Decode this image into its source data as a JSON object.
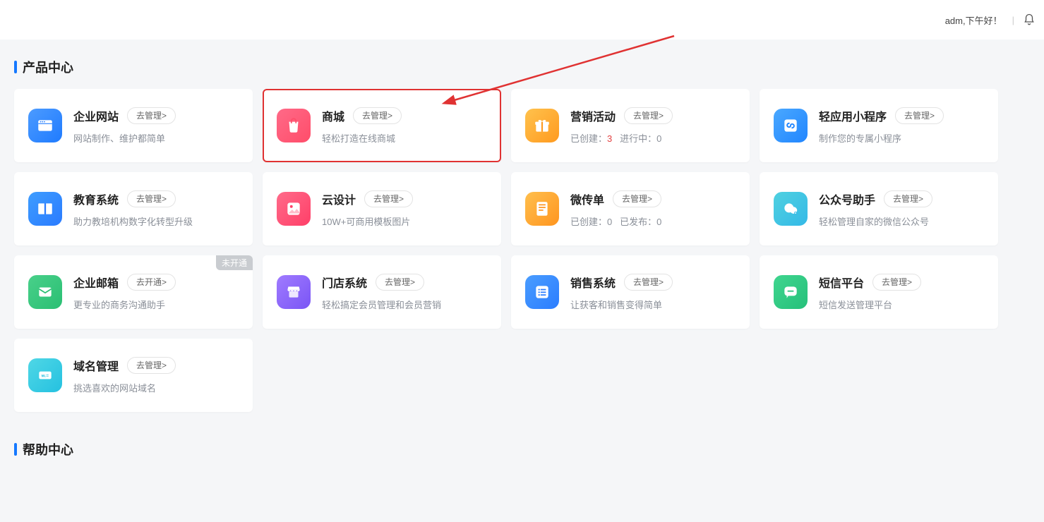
{
  "header": {
    "greeting": "adm,下午好！"
  },
  "sections": {
    "products": "产品中心",
    "help": "帮助中心"
  },
  "badge_unopened": "未开通",
  "cards": [
    {
      "title": "企业网站",
      "btn": "去管理>",
      "sub": "网站制作、维护都简单",
      "icon": "window-icon",
      "bg": "bg-blue"
    },
    {
      "title": "商城",
      "btn": "去管理>",
      "sub": "轻松打造在线商城",
      "icon": "shopping-bag-icon",
      "bg": "bg-pink",
      "highlight": true
    },
    {
      "title": "营销活动",
      "btn": "去管理>",
      "sub_label1": "已创建：",
      "sub_val1": "3",
      "sub_label2": "进行中：",
      "sub_val2": "0",
      "icon": "gift-icon",
      "bg": "bg-orange",
      "stats": true
    },
    {
      "title": "轻应用小程序",
      "btn": "去管理>",
      "sub": "制作您的专属小程序",
      "icon": "miniapp-icon",
      "bg": "bg-blue2"
    },
    {
      "title": "教育系统",
      "btn": "去管理>",
      "sub": "助力教培机构数字化转型升级",
      "icon": "book-icon",
      "bg": "bg-blue3"
    },
    {
      "title": "云设计",
      "btn": "去管理>",
      "sub": "10W+可商用模板图片",
      "icon": "image-icon",
      "bg": "bg-pink2"
    },
    {
      "title": "微传单",
      "btn": "去管理>",
      "sub_label1": "已创建：",
      "sub_val1": "0",
      "sub_label2": "已发布：",
      "sub_val2": "0",
      "icon": "flyer-icon",
      "bg": "bg-orange2",
      "stats": true,
      "val1_gray": true
    },
    {
      "title": "公众号助手",
      "btn": "去管理>",
      "sub": "轻松管理自家的微信公众号",
      "icon": "wechat-icon",
      "bg": "bg-wechat"
    },
    {
      "title": "企业邮箱",
      "btn": "去开通>",
      "sub": "更专业的商务沟通助手",
      "icon": "mail-icon",
      "bg": "bg-green",
      "badge": true
    },
    {
      "title": "门店系统",
      "btn": "去管理>",
      "sub": "轻松搞定会员管理和会员营销",
      "icon": "store-icon",
      "bg": "bg-purple"
    },
    {
      "title": "销售系统",
      "btn": "去管理>",
      "sub": "让获客和销售变得简单",
      "icon": "list-icon",
      "bg": "bg-bluef"
    },
    {
      "title": "短信平台",
      "btn": "去管理>",
      "sub": "短信发送管理平台",
      "icon": "message-icon",
      "bg": "bg-msg"
    },
    {
      "title": "域名管理",
      "btn": "去管理>",
      "sub": "挑选喜欢的网站域名",
      "icon": "domain-icon",
      "bg": "bg-cyan"
    }
  ]
}
